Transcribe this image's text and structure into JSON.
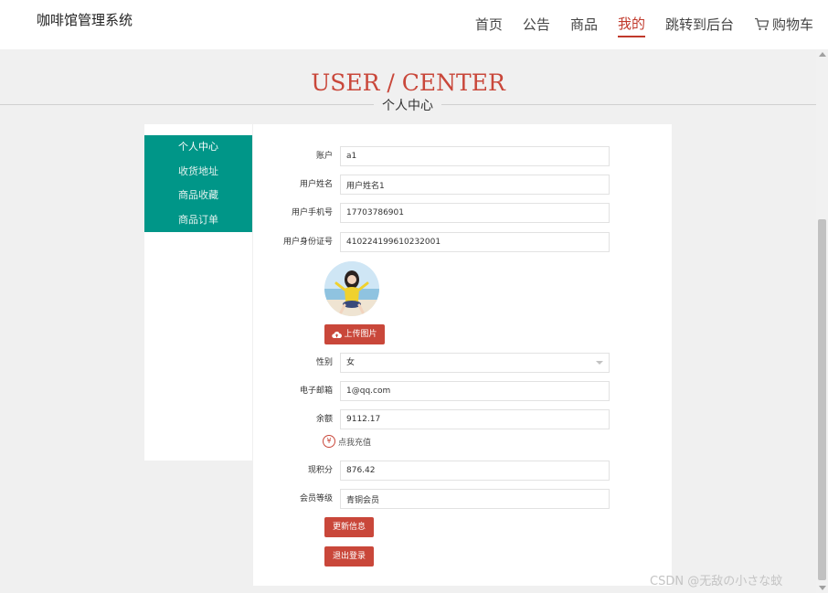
{
  "header": {
    "brand": "咖啡馆管理系统",
    "nav": [
      "首页",
      "公告",
      "商品",
      "我的",
      "跳转到后台",
      "购物车"
    ],
    "active_nav": "我的"
  },
  "hero": {
    "title": "USER / CENTER",
    "subtitle": "个人中心"
  },
  "sidebar": {
    "items": [
      "个人中心",
      "收货地址",
      "商品收藏",
      "商品订单"
    ],
    "active_item": "个人中心"
  },
  "form": {
    "account": {
      "label": "账户",
      "value": "a1"
    },
    "name": {
      "label": "用户姓名",
      "value": "用户姓名1"
    },
    "phone": {
      "label": "用户手机号",
      "value": "17703786901"
    },
    "id_number": {
      "label": "用户身份证号",
      "value": "410224199610232001"
    },
    "upload_label": "上传图片",
    "gender": {
      "label": "性别",
      "value": "女"
    },
    "email": {
      "label": "电子邮箱",
      "value": "1@qq.com"
    },
    "balance": {
      "label": "余额",
      "value": "9112.17"
    },
    "recharge_label": "点我充值",
    "recharge_icon_glyph": "¥",
    "points": {
      "label": "现积分",
      "value": "876.42"
    },
    "level": {
      "label": "会员等级",
      "value": "青铜会员"
    },
    "update_button": "更新信息",
    "logout_button": "退出登录"
  },
  "watermark": "CSDN @无敌の小さな蚊",
  "colors": {
    "accent_red": "#c9473a",
    "sidebar_teal": "#009688",
    "page_bg": "#f0f0f0"
  },
  "icons": {
    "cart": "cart-icon",
    "upload": "cloud-upload-icon",
    "recharge": "yen-circle-icon"
  }
}
